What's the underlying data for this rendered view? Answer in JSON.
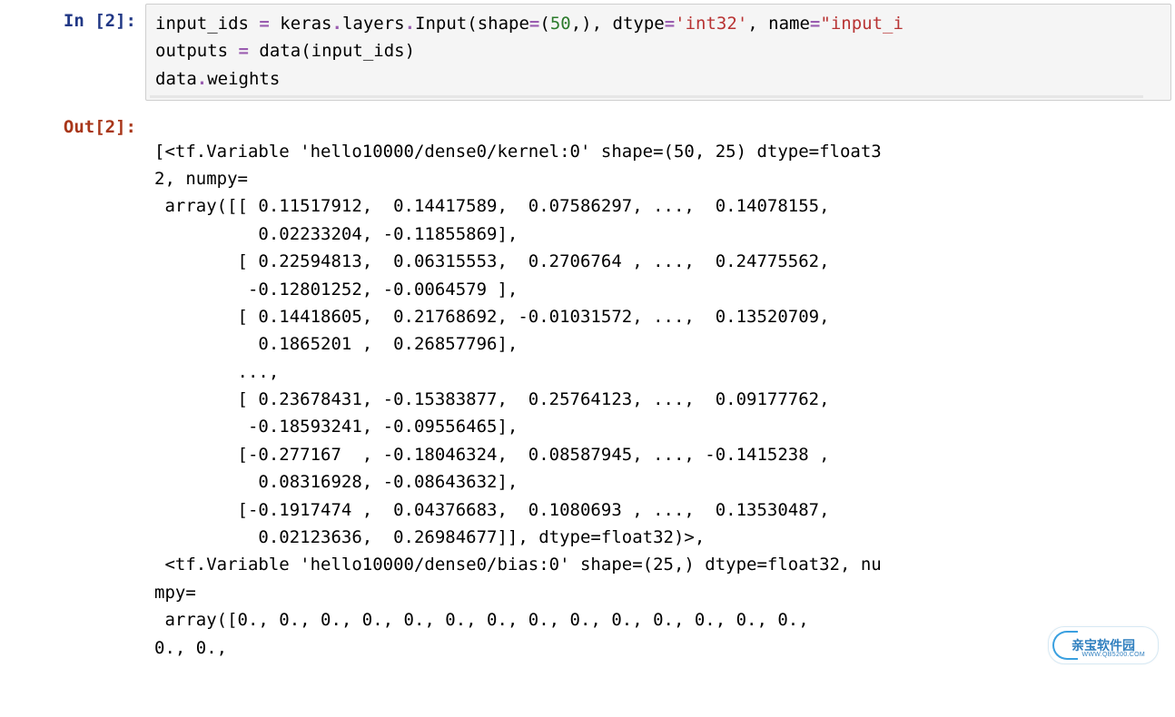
{
  "in_prompt": "In [2]:",
  "out_prompt": "Out[2]:",
  "code": {
    "l1": {
      "a": "input_ids ",
      "eq": "=",
      "sp": " ",
      "call": "keras",
      "dot1": ".",
      "layers": "layers",
      "dot2": ".",
      "Input": "Input",
      "lp": "(",
      "shape_k": "shape",
      "eq2": "=",
      "lp2": "(",
      "fifty": "50",
      "comma50": ",",
      "rp2": ")",
      "comma1": ", ",
      "dtype_k": "dtype",
      "eq3": "=",
      "q1": "'",
      "int32": "int32",
      "q2": "'",
      "comma2": ", ",
      "name_k": "name",
      "eq4": "=",
      "dq": "\"",
      "name_v": "input_",
      "tail": "i"
    },
    "l2": {
      "a": "outputs ",
      "eq": "=",
      "sp": " ",
      "call": "data",
      "lp": "(",
      "arg": "input_ids",
      "rp": ")"
    },
    "l3": {
      "a": "data",
      "dot": ".",
      "b": "weights"
    }
  },
  "output_text": "[<tf.Variable 'hello10000/dense0/kernel:0' shape=(50, 25) dtype=float3\n2, numpy=\n array([[ 0.11517912,  0.14417589,  0.07586297, ...,  0.14078155,\n          0.02233204, -0.11855869],\n        [ 0.22594813,  0.06315553,  0.2706764 , ...,  0.24775562,\n         -0.12801252, -0.0064579 ],\n        [ 0.14418605,  0.21768692, -0.01031572, ...,  0.13520709,\n          0.1865201 ,  0.26857796],\n        ...,\n        [ 0.23678431, -0.15383877,  0.25764123, ...,  0.09177762,\n         -0.18593241, -0.09556465],\n        [-0.277167  , -0.18046324,  0.08587945, ..., -0.1415238 ,\n          0.08316928, -0.08643632],\n        [-0.1917474 ,  0.04376683,  0.1080693 , ...,  0.13530487,\n          0.02123636,  0.26984677]], dtype=float32)>,\n <tf.Variable 'hello10000/dense0/bias:0' shape=(25,) dtype=float32, nu\nmpy=\n array([0., 0., 0., 0., 0., 0., 0., 0., 0., 0., 0., 0., 0., 0.,\n0., 0.,",
  "watermark": {
    "main": "亲宝软件园",
    "sub": "WWW.QB5200.COM"
  }
}
